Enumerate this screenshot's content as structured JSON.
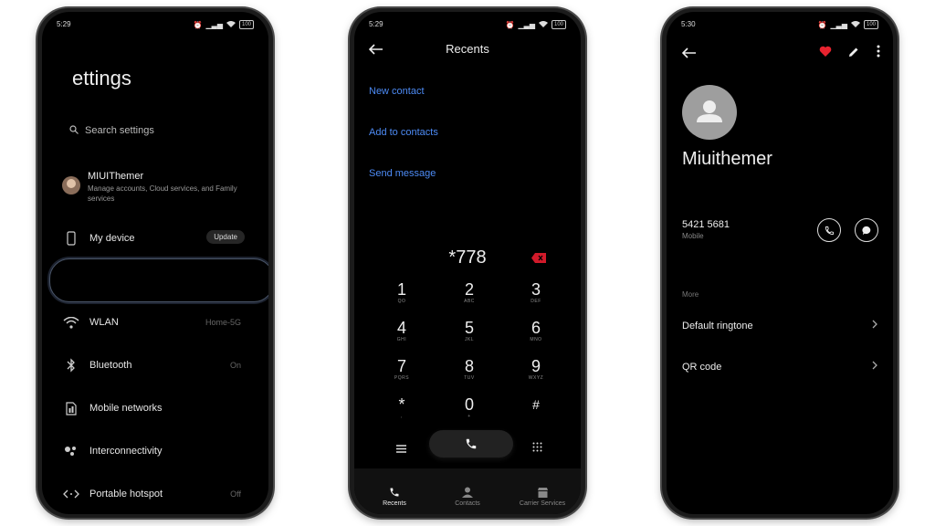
{
  "status_bar": [
    {
      "time": "5:29",
      "battery": "100"
    },
    {
      "time": "5:29",
      "battery": "100"
    },
    {
      "time": "5:30",
      "battery": "100"
    }
  ],
  "settings": {
    "title": "ettings",
    "search_placeholder": "Search settings",
    "account": {
      "name": "MIUIThemer",
      "desc": "Manage accounts, Cloud services, and Family services"
    },
    "my_device": {
      "label": "My device",
      "badge": "Update"
    },
    "items": [
      {
        "label": "WLAN",
        "value": "Home-5G",
        "icon": "wifi-icon"
      },
      {
        "label": "Bluetooth",
        "value": "On",
        "icon": "bluetooth-icon"
      },
      {
        "label": "Mobile networks",
        "value": "",
        "icon": "sim-card-icon"
      },
      {
        "label": "Interconnectivity",
        "value": "",
        "icon": "interconnectivity-icon"
      },
      {
        "label": "Portable hotspot",
        "value": "Off",
        "icon": "hotspot-icon"
      }
    ]
  },
  "dialer": {
    "title": "Recents",
    "actions": [
      "New contact",
      "Add to contacts",
      "Send message"
    ],
    "number": "*778",
    "keys": [
      {
        "d": "1",
        "l": "QO"
      },
      {
        "d": "2",
        "l": "ABC"
      },
      {
        "d": "3",
        "l": "DEF"
      },
      {
        "d": "4",
        "l": "GHI"
      },
      {
        "d": "5",
        "l": "JKL"
      },
      {
        "d": "6",
        "l": "MNO"
      },
      {
        "d": "7",
        "l": "PQRS"
      },
      {
        "d": "8",
        "l": "TUV"
      },
      {
        "d": "9",
        "l": "WXYZ"
      },
      {
        "d": "*",
        "l": ","
      },
      {
        "d": "0",
        "l": "+"
      },
      {
        "d": "#",
        "l": ""
      }
    ],
    "tabs": [
      "Recents",
      "Contacts",
      "Carrier Services"
    ]
  },
  "contact": {
    "name": "Miuithemer",
    "phone": "5421 5681",
    "phone_type": "Mobile",
    "section": "More",
    "rows": [
      "Default ringtone",
      "QR code"
    ],
    "colors": {
      "favorite": "#e8232f"
    }
  },
  "colors": {
    "accent": "#4d8bf5",
    "delete": "#d11a2a"
  }
}
